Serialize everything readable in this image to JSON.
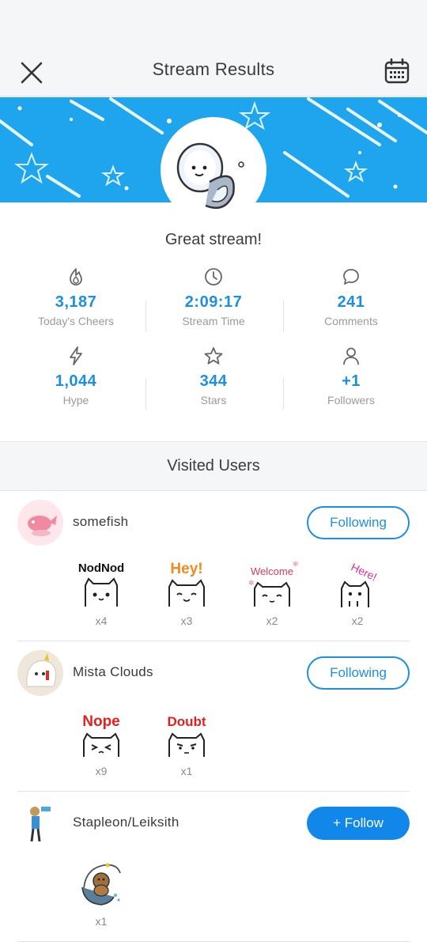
{
  "header": {
    "title": "Stream Results"
  },
  "greeting": "Great stream!",
  "stats": [
    {
      "icon": "flame-icon",
      "value": "3,187",
      "label": "Today's Cheers"
    },
    {
      "icon": "clock-icon",
      "value": "2:09:17",
      "label": "Stream Time"
    },
    {
      "icon": "comment-icon",
      "value": "241",
      "label": "Comments"
    },
    {
      "icon": "lightning-icon",
      "value": "1,044",
      "label": "Hype"
    },
    {
      "icon": "star-icon",
      "value": "344",
      "label": "Stars"
    },
    {
      "icon": "person-icon",
      "value": "+1",
      "label": "Followers"
    }
  ],
  "visited": {
    "title": "Visited Users"
  },
  "users": [
    {
      "name": "somefish",
      "button": "Following",
      "stickers": [
        {
          "text": "NodNod",
          "color": "#111111",
          "count": "x4"
        },
        {
          "text": "Hey!",
          "color": "#f08a1e",
          "count": "x3"
        },
        {
          "text": "Welcome",
          "color": "#d83a5a",
          "count": "x2"
        },
        {
          "text": "Here!",
          "color": "#e0308e",
          "count": "x2"
        }
      ]
    },
    {
      "name": "Mista Clouds",
      "button": "Following",
      "stickers": [
        {
          "text": "Nope",
          "color": "#e0221e",
          "count": "x9"
        },
        {
          "text": "Doubt",
          "color": "#e0221e",
          "count": "x1"
        }
      ]
    },
    {
      "name": "Stapleon/Leiksith",
      "button": "+ Follow",
      "stickers": [
        {
          "text": "",
          "color": "#333333",
          "count": "x1"
        }
      ]
    }
  ],
  "colors": {
    "accent": "#1d8fe0",
    "banner": "#1ea5ee",
    "follow_bg": "#1287ea"
  }
}
